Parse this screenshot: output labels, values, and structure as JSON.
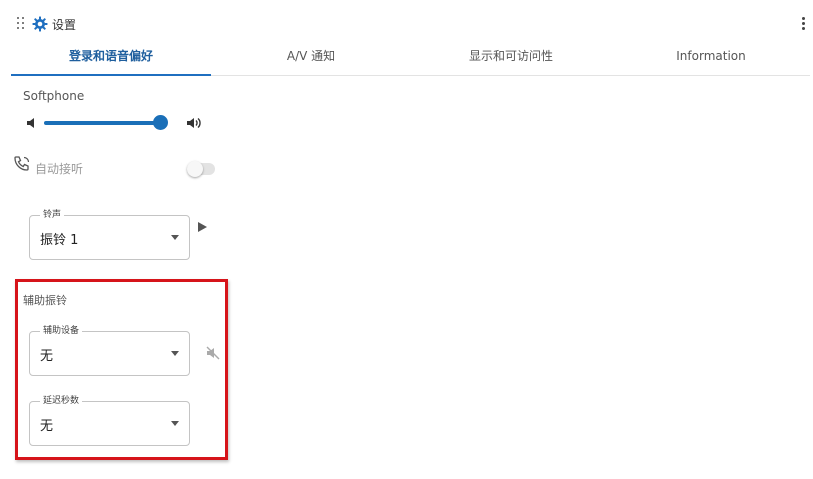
{
  "app": {
    "title": "设置",
    "gear_icon": "gear-icon",
    "accent": "#1f6fc0"
  },
  "tabs": [
    {
      "label": "登录和语音偏好",
      "active": true
    },
    {
      "label": "A/V 通知",
      "active": false
    },
    {
      "label": "显示和可访问性",
      "active": false
    },
    {
      "label": "Information",
      "active": false
    }
  ],
  "softphone": {
    "label": "Softphone",
    "volume_fraction": 1.0,
    "auto_answer": {
      "label": "自动接听",
      "enabled": false
    },
    "ringtone": {
      "legend": "铃声",
      "value": "振铃 1"
    }
  },
  "secondary_ring": {
    "label": "辅助振铃",
    "device": {
      "legend": "辅助设备",
      "value": "无"
    },
    "delay": {
      "legend": "延迟秒数",
      "value": "无"
    },
    "highlight_color": "#d6141a"
  }
}
